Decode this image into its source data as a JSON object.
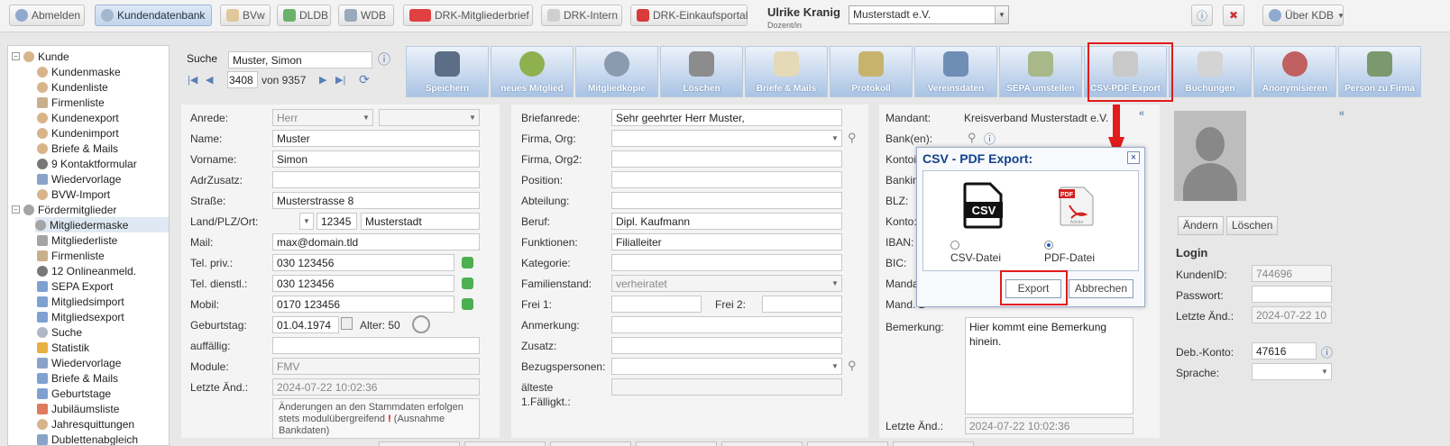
{
  "topbar": {
    "buttons": [
      {
        "label": "Abmelden",
        "icon": "logout-icon"
      },
      {
        "label": "Kundendatenbank",
        "icon": "user-icon",
        "active": true
      },
      {
        "label": "BVw",
        "icon": "document-icon"
      },
      {
        "label": "DLDB",
        "icon": "db-icon"
      },
      {
        "label": "WDB",
        "icon": "window-icon"
      },
      {
        "label": "DRK-Mitgliederbrief",
        "icon": "mail-icon"
      },
      {
        "label": "DRK-Intern",
        "icon": "cross-icon"
      },
      {
        "label": "DRK-Einkaufsportal",
        "icon": "cart-icon"
      }
    ],
    "user_name": "Ulrike Kranig",
    "user_role": "Dozent/in",
    "mandant_select": "Musterstadt e.V.",
    "about_label": "Über KDB"
  },
  "sidebar": {
    "group1": "Kunde",
    "group1_items": [
      "Kundenmaske",
      "Kundenliste",
      "Firmenliste",
      "Kundenexport",
      "Kundenimport",
      "Briefe & Mails",
      "9  Kontaktformular",
      "Wiedervorlage",
      "BVW-Import"
    ],
    "group2": "Fördermitglieder",
    "group2_items": [
      "Mitgliedermaske",
      "Mitgliederliste",
      "Firmenliste",
      "12  Onlineanmeld.",
      "SEPA Export",
      "Mitgliedsimport",
      "Mitgliedsexport",
      "Suche",
      "Statistik",
      "Wiedervorlage",
      "Briefe & Mails",
      "Geburtstage",
      "Jubiläumsliste",
      "Jahresquittungen",
      "Dublettenabgleich"
    ]
  },
  "search": {
    "label": "Suche",
    "value": "Muster, Simon",
    "record": "3408",
    "of_label": "von 9357"
  },
  "toolbar": [
    "Speichern",
    "neues Mitglied",
    "Mitgliedkopie",
    "Löschen",
    "Briefe & Mails",
    "Protokoll",
    "Vereinsdaten",
    "SEPA umstellen",
    "CSV-PDF Export",
    "Buchungen",
    "Anonymisieren",
    "Person zu Firma"
  ],
  "col1": {
    "anrede_label": "Anrede:",
    "anrede_value": "Herr",
    "name_label": "Name:",
    "name_value": "Muster",
    "vorname_label": "Vorname:",
    "vorname_value": "Simon",
    "adrzusatz_label": "AdrZusatz:",
    "strasse_label": "Straße:",
    "strasse_value": "Musterstrasse 8",
    "land_label": "Land/PLZ/Ort:",
    "plz_value": "12345",
    "ort_value": "Musterstadt",
    "mail_label": "Mail:",
    "mail_value": "max@domain.tld",
    "telpriv_label": "Tel. priv.:",
    "telpriv_value": "030 123456",
    "teldienst_label": "Tel. dienstl.:",
    "teldienst_value": "030 123456",
    "mobil_label": "Mobil:",
    "mobil_value": "0170 123456",
    "geburtstag_label": "Geburtstag:",
    "geburtstag_value": "01.04.1974",
    "alter_label": "Alter: 50",
    "auffaellig_label": "auffällig:",
    "module_label": "Module:",
    "module_value": "FMV",
    "letzte_label": "Letzte Änd.:",
    "letzte_value": "2024-07-22 10:02:36",
    "note_text1": "Änderungen an den Stammdaten erfolgen stets modulübergreifend ",
    "note_ex": "!",
    "note_text2": " (Ausnahme Bankdaten)"
  },
  "col2": {
    "briefanrede_label": "Briefanrede:",
    "briefanrede_value": "Sehr geehrter Herr Muster,",
    "firma_label": "Firma, Org:",
    "firma2_label": "Firma, Org2:",
    "position_label": "Position:",
    "abteilung_label": "Abteilung:",
    "beruf_label": "Beruf:",
    "beruf_value": "Dipl. Kaufmann",
    "funktionen_label": "Funktionen:",
    "funktionen_value": "Filialleiter",
    "kategorie_label": "Kategorie:",
    "familienstand_label": "Familienstand:",
    "familienstand_value": "verheiratet",
    "frei1_label": "Frei 1:",
    "frei2_label": "Frei 2:",
    "anmerkung_label": "Anmerkung:",
    "zusatz_label": "Zusatz:",
    "bezugspersonen_label": "Bezugspersonen:",
    "faelligkt_label1": "älteste",
    "faelligkt_label2": "1.Fälligkt.:"
  },
  "col3": {
    "mandant_label": "Mandant:",
    "mandant_value": "Kreisverband Musterstadt e.V.",
    "bank_label": "Bank(en):",
    "kontoinh_label": "Kontoi",
    "bankname_label": "Bankin",
    "blz_label": "BLZ:",
    "konto_label": "Konto:",
    "iban_label": "IBAN:",
    "bic_label": "BIC:",
    "mandat_label": "Manda",
    "mandatdatum_label": "Mand. D",
    "bemerkung_label": "Bemerkung:",
    "bemerkung_value": "Hier kommt eine Bemerkung hinein.",
    "letzte_label": "Letzte Änd.:",
    "letzte_value": "2024-07-22 10:02:36"
  },
  "col4": {
    "aendern": "Ändern",
    "loeschen": "Löschen",
    "login_title": "Login",
    "kundenid_label": "KundenID:",
    "kundenid_value": "744696",
    "passwort_label": "Passwort:",
    "letzte_label": "Letzte Änd.:",
    "letzte_value": "2024-07-22 10",
    "debkonto_label": "Deb.-Konto:",
    "debkonto_value": "47616",
    "sprache_label": "Sprache:"
  },
  "dialog": {
    "title": "CSV - PDF Export:",
    "csv_label": "CSV-Datei",
    "csv_icon_text": "CSV",
    "pdf_label": "PDF-Datei",
    "pdf_icon_text": "PDF",
    "pdf_brand": "Adobe",
    "export": "Export",
    "cancel": "Abbrechen",
    "selected": "pdf"
  },
  "colors": {
    "accent": "#15428b",
    "highlight": "#e21b1b",
    "toolbar": "#a9c3e4"
  }
}
